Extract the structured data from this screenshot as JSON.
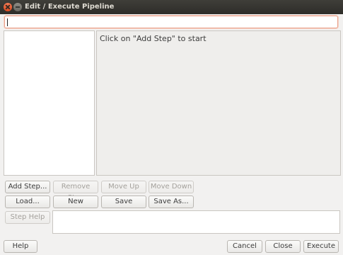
{
  "window": {
    "title": "Edit / Execute Pipeline"
  },
  "pipeline_name": {
    "value": ""
  },
  "detail": {
    "hint": "Click on \"Add Step\" to start"
  },
  "steps": [],
  "buttons": {
    "add_step": "Add Step...",
    "remove_step": "Remove Step",
    "move_up": "Move Up",
    "move_down": "Move Down",
    "load": "Load...",
    "new": "New",
    "save": "Save",
    "save_as": "Save As...",
    "step_help": "Step Help",
    "help": "Help",
    "cancel": "Cancel",
    "close": "Close",
    "execute": "Execute"
  },
  "colors": {
    "titlebar": "#2e2d29",
    "close_button": "#de4b1f",
    "focus_border": "#e8a08a",
    "window_bg": "#f2f1f0"
  }
}
